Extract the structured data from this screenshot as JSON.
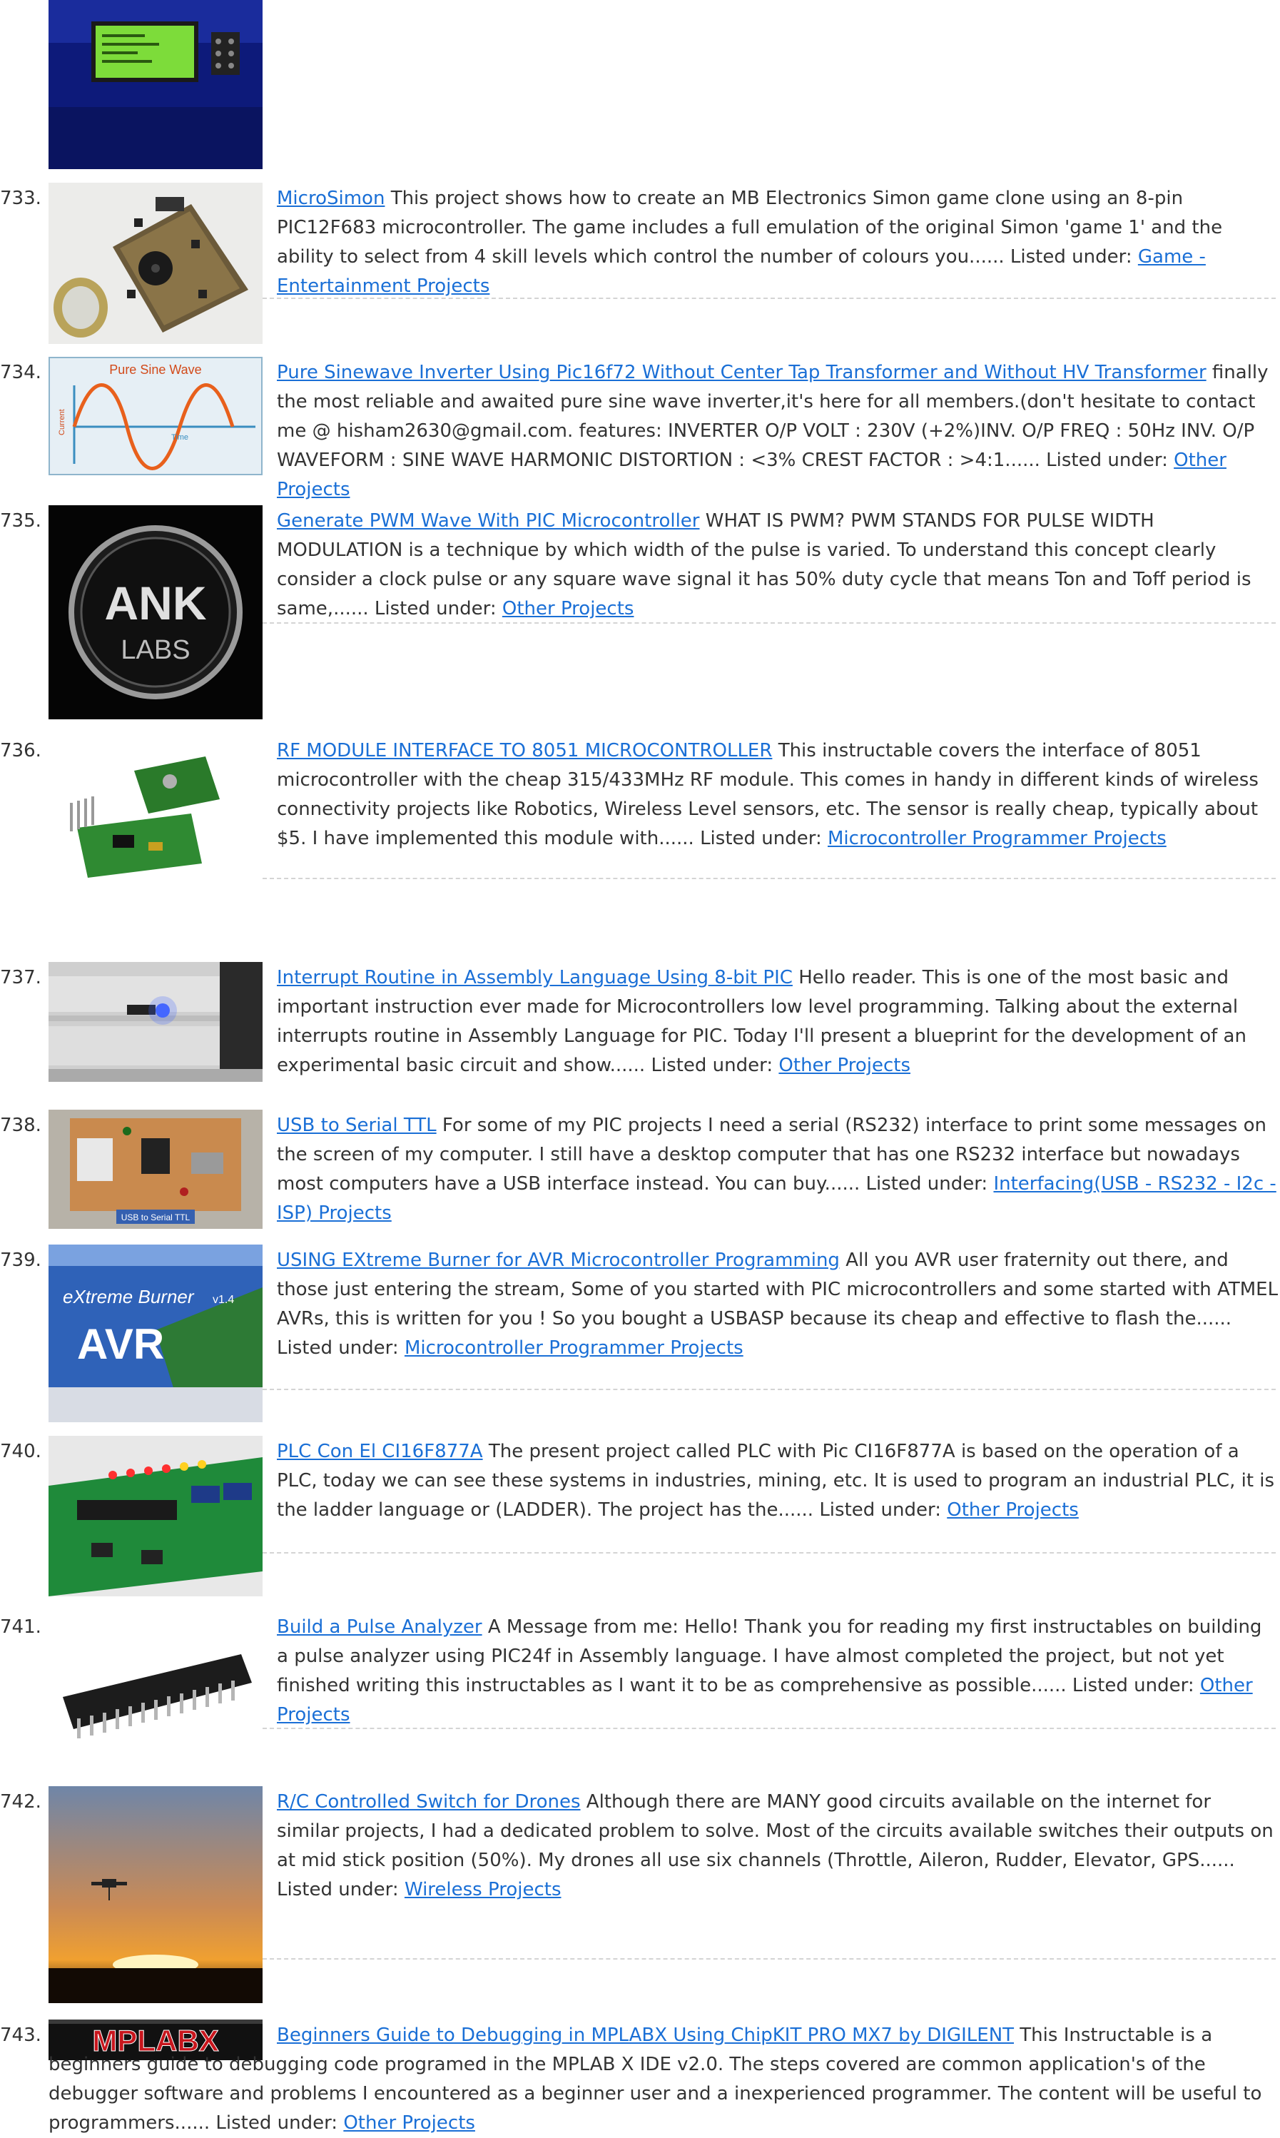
{
  "list": {
    "listed_label": "Listed under:",
    "items": [
      {
        "number": "",
        "title": "",
        "description": "",
        "category": "",
        "thumbnail": "lcd-display-unit-photo"
      },
      {
        "number": "733.",
        "title": "MicroSimon",
        "description": "This project shows how to create an MB Electronics Simon game clone using an 8-pin PIC12F683 microcontroller. The game includes a full emulation of the original Simon 'game 1' and the ability to select from 4 skill levels which control the number of colours you......",
        "category": "Game - Entertainment Projects",
        "thumbnail": "simon-game-board-photo"
      },
      {
        "number": "734.",
        "title": "Pure Sinewave Inverter Using Pic16f72 Without Center Tap Transformer and Without HV Transformer",
        "description": "finally the most reliable and awaited pure sine wave inverter,it's here for all members.(don't hesitate to contact me @ hisham2630@gmail.com. features: INVERTER O/P VOLT : 230V (+2%)INV. O/P FREQ : 50Hz INV. O/P WAVEFORM : SINE WAVE HARMONIC DISTORTION : <3% CREST FACTOR : >4:1......",
        "category": "Other Projects",
        "thumbnail": "pure-sine-wave-graphic",
        "thumb_text": {
          "heading": "Pure Sine Wave",
          "y_label": "Current",
          "x_label": "Time"
        }
      },
      {
        "number": "735.",
        "title": "Generate PWM Wave With PIC Microcontroller",
        "description": "WHAT IS PWM? PWM STANDS FOR PULSE WIDTH MODULATION is a technique by which width of the pulse is varied. To understand this concept clearly consider a clock pulse or any square wave signal it has 50% duty cycle that means Ton and Toff period is same,......",
        "category": "Other Projects",
        "thumbnail": "ank-labs-logo",
        "thumb_text": {
          "line1": "ANK",
          "line2": "LABS"
        }
      },
      {
        "number": "736.",
        "title": "RF MODULE INTERFACE TO 8051 MICROCONTROLLER",
        "description": "This instructable covers the interface of 8051 microcontroller with the cheap 315/433MHz RF module. This comes in handy in different kinds of wireless connectivity projects like Robotics, Wireless Level sensors, etc. The sensor is really cheap, typically about $5. I have implemented this module with......",
        "category": "Microcontroller Programmer Projects",
        "thumbnail": "rf-module-photo"
      },
      {
        "number": "737.",
        "title": "Interrupt Routine in Assembly Language Using 8-bit PIC",
        "description": "Hello reader. This is one of the most basic and important instruction ever made for Microcontrollers low level programming. Talking about the external interrupts routine in Assembly Language for PIC. Today I'll present a blueprint for the development of an experimental basic circuit and show......",
        "category": "Other Projects",
        "thumbnail": "breadboard-photo"
      },
      {
        "number": "738.",
        "title": "USB to Serial TTL",
        "description": "For some of my PIC projects I need a serial (RS232) interface to print some messages on the screen of my computer. I still have a desktop computer that has one RS232 interface but nowadays most computers have a USB interface instead. You can buy......",
        "category": "Interfacing(USB - RS232 - I2c -ISP) Projects",
        "thumbnail": "usb-serial-board-photo",
        "thumb_text": {
          "label": "USB to Serial TTL"
        }
      },
      {
        "number": "739.",
        "title": "USING EXtreme Burner for AVR Microcontroller Programming",
        "description": "All you AVR user fraternity out there, and those just entering the stream, Some of you started with PIC microcontrollers and some started with ATMEL AVRs, this is written for you ! So you bought a USBASP because its cheap and effective to flash the......",
        "category": "Microcontroller Programmer Projects",
        "thumbnail": "extreme-burner-splash",
        "thumb_text": {
          "brand": "eXtreme Burner",
          "product": "AVR",
          "version": "v1.4"
        }
      },
      {
        "number": "740.",
        "title": "PLC Con El CI16F877A",
        "description": "The present project called PLC with Pic CI16F877A is based on the operation of a PLC, today we can see these systems in industries, mining, etc. It is used to program an industrial PLC, it is the ladder language or (LADDER). The project has the......",
        "category": "Other Projects",
        "thumbnail": "plc-board-photo"
      },
      {
        "number": "741.",
        "title": "Build a Pulse Analyzer",
        "description": "A Message from me: Hello! Thank you for reading my first instructables on building a pulse analyzer using PIC24f in Assembly language. I have almost completed the project, but not yet finished writing this instructables as I want it to be as comprehensive as possible......",
        "category": "Other Projects",
        "thumbnail": "dip-chip-photo"
      },
      {
        "number": "742.",
        "title": "R/C Controlled Switch for Drones",
        "description": "Although there are MANY good circuits available on the internet for similar projects, I had a dedicated problem to solve. Most of the circuits available switches their outputs on at mid stick position (50%). My drones all use six channels (Throttle, Aileron, Rudder, Elevator, GPS......",
        "category": "Wireless Projects",
        "thumbnail": "drone-sunset-photo"
      },
      {
        "number": "743.",
        "title": "Beginners Guide to Debugging in MPLABX Using ChipKIT PRO MX7 by DIGILENT",
        "description": "This Instructable is a beginners guide to debugging code programed in the MPLAB X IDE v2.0. The steps covered are common application's of the debugger software and problems I encountered as a beginner user and a inexperienced programmer. The content will be useful to programmers......",
        "category": "Other Projects",
        "thumbnail": "mplabx-logo-banner",
        "thumb_text": {
          "logo": "MPLABX"
        }
      }
    ]
  }
}
